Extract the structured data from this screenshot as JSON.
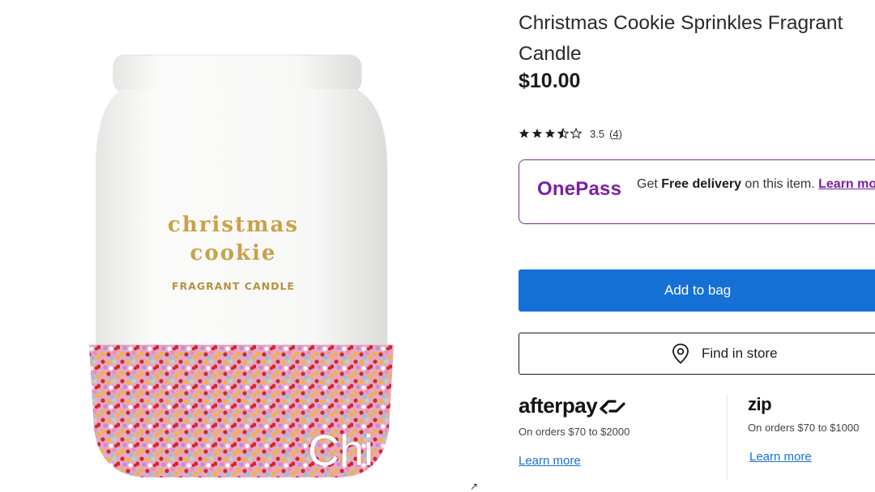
{
  "product": {
    "title": "Christmas Cookie Sprinkles Fragrant Candle",
    "price": "$10.00",
    "rating_value": "3.5",
    "rating_count": "(4)",
    "stars_filled": 3.5,
    "stars_total": 5,
    "image": {
      "label_line1": "christmas",
      "label_line2": "cookie",
      "label_line3": "FRAGRANT CANDLE",
      "overlay_text": "Chi"
    }
  },
  "onepass": {
    "logo": "OnePass",
    "text_prefix": "Get ",
    "text_bold": "Free delivery",
    "text_suffix": " on this item. ",
    "link": "Learn more",
    "brand_color": "#7b1fa2"
  },
  "actions": {
    "add_to_bag": "Add to bag",
    "find_in_store": "Find in store",
    "primary_color": "#1570d6"
  },
  "payments": {
    "afterpay": {
      "logo": "afterpay",
      "note": "On orders $70 to $2000",
      "link": "Learn more"
    },
    "zip": {
      "logo": "zip",
      "note": "On orders $70 to $1000",
      "link": "Learn more"
    }
  }
}
